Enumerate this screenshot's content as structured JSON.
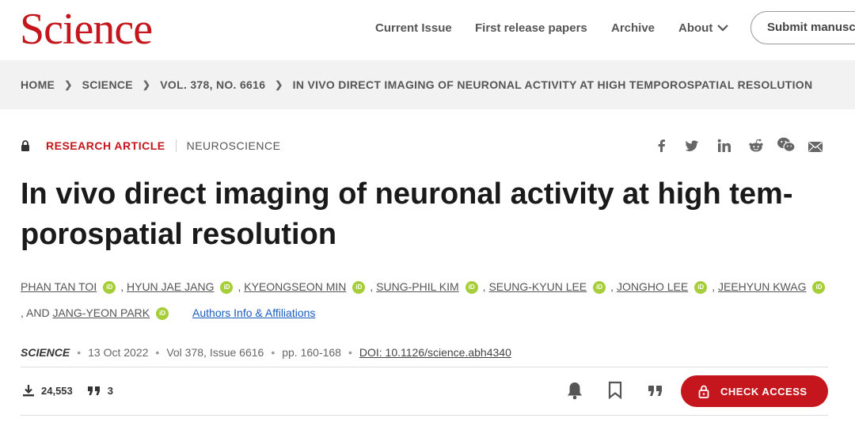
{
  "header": {
    "logo": "Science",
    "nav": [
      "Current Issue",
      "First release papers",
      "Archive",
      "About"
    ],
    "submit_label": "Submit manusc"
  },
  "breadcrumb": [
    "HOME",
    "SCIENCE",
    "VOL. 378, NO. 6616",
    "IN VIVO DIRECT IMAGING OF NEURONAL ACTIVITY AT HIGH TEMPOROSPATIAL RESOLUTION"
  ],
  "article": {
    "type": "RESEARCH ARTICLE",
    "subject": "NEUROSCIENCE",
    "title_line1": "In vivo direct imaging of neuronal activity at high tem-",
    "title_line2": "porospatial resolution",
    "authors": [
      "PHAN TAN TOI",
      "HYUN JAE JANG",
      "KYEONGSEON MIN",
      "SUNG-PHIL KIM",
      "SEUNG-KYUN LEE",
      "JONGHO LEE",
      "JEEHYUN KWAG",
      "JANG-YEON PARK"
    ],
    "and_label": ", AND",
    "orcid_label": "iD",
    "affiliations_link": "Authors Info & Affiliations",
    "journal": "SCIENCE",
    "date": "13 Oct 2022",
    "volume": "Vol 378, Issue 6616",
    "pages": "pp. 160-168",
    "doi": "DOI: 10.1126/science.abh4340"
  },
  "metrics": {
    "downloads": "24,553",
    "citations": "3"
  },
  "access_button": "CHECK ACCESS",
  "icons": [
    "lock-icon",
    "facebook-icon",
    "twitter-icon",
    "linkedin-icon",
    "reddit-icon",
    "wechat-icon",
    "email-icon",
    "download-icon",
    "quote-icon",
    "bell-icon",
    "bookmark-icon",
    "cite-icon"
  ],
  "colors": {
    "brand": "#c4161c",
    "orcid": "#a6ce39",
    "link": "#1a5bbf"
  }
}
